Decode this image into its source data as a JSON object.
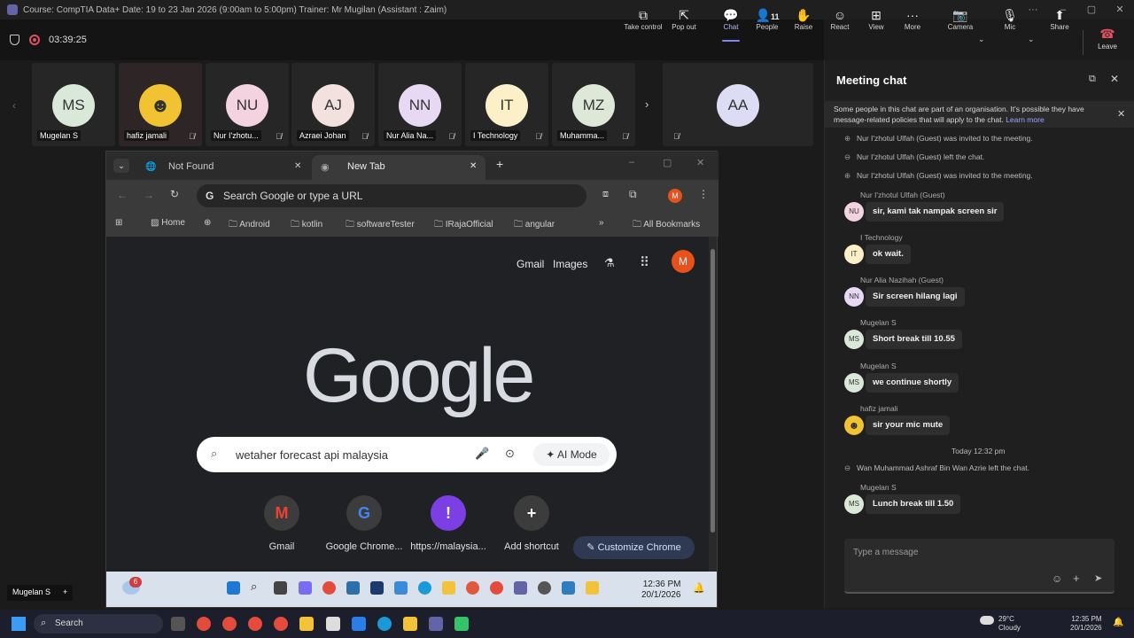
{
  "window": {
    "title": "Course: CompTIA Data+ Date: 19 to 23 Jan 2026 (9:00am to 5:00pm) Trainer: Mr Mugilan (Assistant : Zaim)"
  },
  "meeting": {
    "timer": "03:39:25",
    "toolbar": [
      {
        "label": "Take control",
        "icon": "take-control-icon"
      },
      {
        "label": "Pop out",
        "icon": "pop-out-icon"
      },
      {
        "label": "Chat",
        "icon": "chat-icon",
        "active": true
      },
      {
        "label": "People",
        "icon": "people-icon",
        "count": "11"
      },
      {
        "label": "Raise",
        "icon": "hand-icon"
      },
      {
        "label": "React",
        "icon": "react-icon"
      },
      {
        "label": "View",
        "icon": "view-icon"
      },
      {
        "label": "More",
        "icon": "more-icon"
      },
      {
        "label": "Camera",
        "icon": "camera-off-icon"
      },
      {
        "label": "Mic",
        "icon": "mic-off-icon"
      },
      {
        "label": "Share",
        "icon": "share-icon"
      }
    ],
    "leave_label": "Leave",
    "participants": [
      {
        "initials": "MS",
        "name": "Mugelan S",
        "color": "#d9e8d8",
        "muted": false
      },
      {
        "initials": "",
        "name": "hafiz jamali",
        "color": "#f1c232",
        "muted": true
      },
      {
        "initials": "NU",
        "name": "Nur I'zhotu...",
        "color": "#f3d3df",
        "muted": true
      },
      {
        "initials": "AJ",
        "name": "Azraei Johan",
        "color": "#f3e1de",
        "muted": true
      },
      {
        "initials": "NN",
        "name": "Nur Alia Na...",
        "color": "#e7d9f3",
        "muted": true
      },
      {
        "initials": "IT",
        "name": "I Technology",
        "color": "#fbf0c8",
        "muted": true
      },
      {
        "initials": "MZ",
        "name": "Muhamma...",
        "color": "#dde8d8",
        "muted": true
      },
      {
        "initials": "AA",
        "name": "",
        "color": "#dcdcf5",
        "muted": true
      }
    ],
    "self_label": "Mugelan S"
  },
  "browser": {
    "tabs": [
      {
        "label": "Not Found",
        "active": false
      },
      {
        "label": "New Tab",
        "active": true
      }
    ],
    "url_placeholder": "Search Google or type a URL",
    "profile_initial": "M",
    "bookmarks": [
      "Home",
      "Android",
      "kotlin",
      "softwareTester",
      "IRajaOfficial",
      "angular"
    ],
    "all_bookmarks": "All Bookmarks",
    "header_links": [
      "Gmail",
      "Images"
    ],
    "logo_text": "Google",
    "search_value": "wetaher forecast api malaysia",
    "ai_mode_label": "AI Mode",
    "shortcuts": [
      {
        "label": "Gmail",
        "glyph": "M",
        "color": "#ea4335"
      },
      {
        "label": "Google Chrome...",
        "glyph": "G",
        "color": "#4285f4"
      },
      {
        "label": "https://malaysia...",
        "glyph": "!",
        "color": "#7b3fe4"
      },
      {
        "label": "Add shortcut",
        "glyph": "+",
        "color": "#ffffff"
      }
    ],
    "customize_label": "Customize Chrome",
    "inner_taskbar": {
      "badge": "6",
      "time": "12:36 PM",
      "date": "20/1/2026"
    }
  },
  "chat": {
    "title": "Meeting chat",
    "notice": "Some people in this chat are part of an organisation. It's possible they have message-related policies that will apply to the chat.",
    "notice_link": "Learn more",
    "system_1": "Nur I'zhotul Ulfah (Guest) was invited to the meeting.",
    "system_2": "Nur I'zhotul Ulfah (Guest) left the chat.",
    "system_3": "Nur I'zhotul Ulfah (Guest) was invited to the meeting.",
    "messages": [
      {
        "sender": "Nur I'zhotul Ulfah (Guest)",
        "initials": "NU",
        "color": "#f3d3df",
        "text": "sir, kami tak nampak screen sir"
      },
      {
        "sender": "I Technology",
        "initials": "IT",
        "color": "#fbf0c8",
        "text": "ok wait."
      },
      {
        "sender": "Nur Alia Nazihah (Guest)",
        "initials": "NN",
        "color": "#e7d9f3",
        "text": "Sir screen hilang lagi"
      },
      {
        "sender": "Mugelan S",
        "initials": "MS",
        "color": "#d9e8d8",
        "text": "Short break till 10.55"
      },
      {
        "sender": "Mugelan S",
        "initials": "MS",
        "color": "#d9e8d8",
        "text": "we continue shortly"
      },
      {
        "sender": "hafiz jamali",
        "initials": "",
        "color": "#f1c232",
        "text": "sir your mic mute"
      }
    ],
    "time_divider": "Today 12:32 pm",
    "system_4": "Wan Muhammad Ashraf Bin Wan Azrie left the chat.",
    "last_message": {
      "sender": "Mugelan S",
      "initials": "MS",
      "color": "#d9e8d8",
      "text": "Lunch break till 1.50"
    },
    "input_placeholder": "Type a message"
  },
  "taskbar": {
    "search_label": "Search",
    "weather_temp": "29°C",
    "weather_desc": "Cloudy",
    "time": "12:35 PM",
    "date": "20/1/2026"
  }
}
